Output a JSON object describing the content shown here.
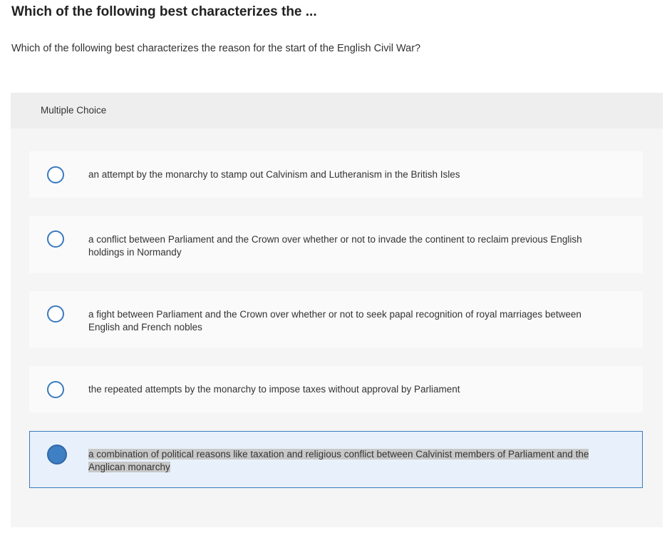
{
  "page": {
    "title": "Which of the following best characterizes the ...",
    "question": "Which of the following best characterizes the reason for the start of the English Civil War?"
  },
  "panel": {
    "type_label": "Multiple Choice"
  },
  "choices": [
    {
      "text": "an attempt by the monarchy to stamp out Calvinism and Lutheranism in the British Isles",
      "selected": false
    },
    {
      "text": "a conflict between Parliament and the Crown over whether or not to invade the continent to reclaim previous English holdings in Normandy",
      "selected": false
    },
    {
      "text": "a fight between Parliament and the Crown over whether or not to seek papal recognition of royal marriages between English and French nobles",
      "selected": false
    },
    {
      "text": "the repeated attempts by the monarchy to impose taxes without approval by Parliament",
      "selected": false
    },
    {
      "text": "a combination of political reasons like taxation and religious conflict between Calvinist members of Parliament and the Anglican monarchy",
      "selected": true
    }
  ],
  "colors": {
    "accent": "#3a7abf",
    "selected_fill": "#3f7fc4",
    "selected_bg": "#e8f1fb",
    "panel_bg": "#f5f5f5",
    "choice_bg": "#fafafa"
  }
}
